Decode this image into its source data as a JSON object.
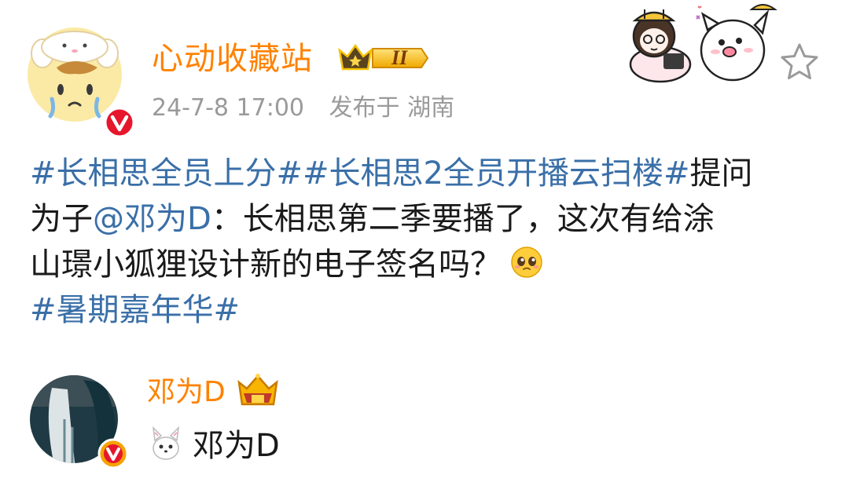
{
  "post": {
    "author": {
      "name": "心动收藏站",
      "level_badge_text": "II"
    },
    "meta": {
      "timestamp": "24-7-8 17:00",
      "posted_at": "发布于 湖南"
    },
    "body_lines": [
      [
        {
          "kind": "hashtag",
          "text": "#长相思全员上分#"
        },
        {
          "kind": "hashtag",
          "text": "#长相思2全员开播云扫楼#"
        },
        {
          "kind": "text",
          "text": "提问"
        }
      ],
      [
        {
          "kind": "text",
          "text": "为子"
        },
        {
          "kind": "mention",
          "text": "@邓为D"
        },
        {
          "kind": "text",
          "text": "：长相思第二季要播了，这次有给涂"
        }
      ],
      [
        {
          "kind": "text",
          "text": "山璟小狐狸设计新的电子签名吗？"
        },
        {
          "kind": "emoji",
          "text": "",
          "icon": "pleading-face-emoji"
        }
      ],
      [
        {
          "kind": "hashtag",
          "text": "#暑期嘉年华#"
        }
      ]
    ]
  },
  "reply": {
    "author_name": "邓为D",
    "content": "邓为D",
    "sticker_icon": "white-fox-sticker-icon"
  },
  "colors": {
    "author_orange": "#ff8200",
    "link_blue": "#3a6fa8",
    "meta_gray": "#9a9a9a",
    "verified_red": "#e6162d",
    "badge_gold": "#f7b500"
  }
}
